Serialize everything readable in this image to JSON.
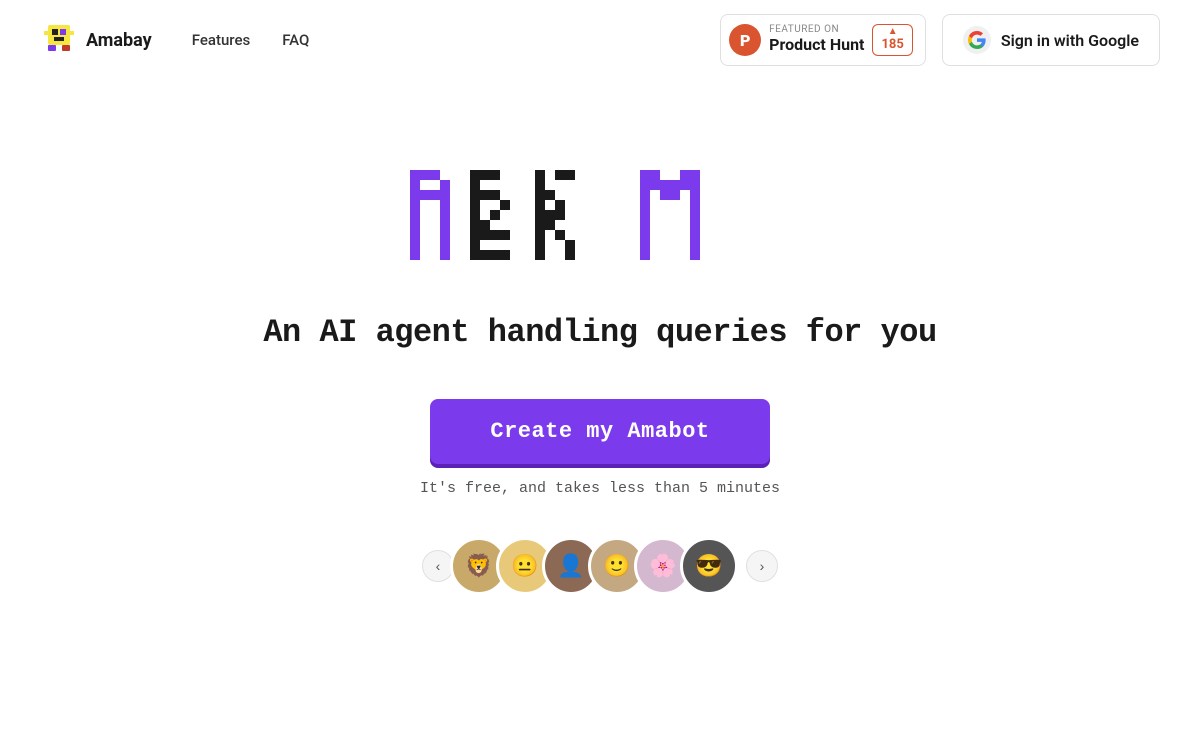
{
  "nav": {
    "logo_text": "Amabay",
    "links": [
      {
        "label": "Features",
        "href": "#features"
      },
      {
        "label": "FAQ",
        "href": "#faq"
      }
    ],
    "ph_badge": {
      "featured_on": "FEATURED ON",
      "product_hunt": "Product Hunt",
      "votes": "185",
      "arrow": "▲"
    },
    "google_btn": {
      "label": "Sign in with Google"
    }
  },
  "hero": {
    "title_ask": "ASK",
    "title_m": "M",
    "subtitle": "An AI agent handling queries for you",
    "cta_label": "Create my Amabot",
    "cta_subtext": "It's free, and takes less than 5 minutes"
  },
  "avatars": [
    {
      "emoji": "🦁",
      "color": "#c8a96a"
    },
    {
      "emoji": "😐",
      "color": "#e8c97a"
    },
    {
      "emoji": "👤",
      "color": "#8b6954"
    },
    {
      "emoji": "🙂",
      "color": "#c4a882"
    },
    {
      "emoji": "🌸",
      "color": "#d4b8d0"
    },
    {
      "emoji": "😎",
      "color": "#555"
    }
  ],
  "nav_prev": "‹",
  "nav_next": "›"
}
